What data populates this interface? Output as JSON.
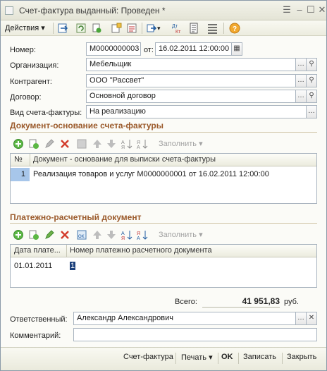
{
  "window": {
    "title": "Счет-фактура выданный: Проведен *"
  },
  "toolbar": {
    "actions_label": "Действия"
  },
  "form": {
    "number_label": "Номер:",
    "number_value": "M0000000003",
    "date_label": "от:",
    "date_value": "16.02.2011 12:00:00",
    "org_label": "Организация:",
    "org_value": "Мебельщик",
    "counterparty_label": "Контрагент:",
    "counterparty_value": "ООО \"Рассвет\"",
    "contract_label": "Договор:",
    "contract_value": "Основной договор",
    "kind_label": "Вид счета-фактуры:",
    "kind_value": "На реализацию"
  },
  "basis": {
    "title": "Документ-основание счета-фактуры",
    "fill_label": "Заполнить",
    "columns": [
      "№",
      "Документ - основание для выписки счета-фактуры"
    ],
    "rows": [
      {
        "n": "1",
        "doc": "Реализация товаров и услуг M0000000001 от 16.02.2011 12:00:00"
      }
    ]
  },
  "payment": {
    "title": "Платежно-расчетный документ",
    "fill_label": "Заполнить",
    "columns": [
      "Дата плате...",
      "Номер платежно расчетного документа"
    ],
    "rows": [
      {
        "date": "01.01.2011",
        "number": "1"
      }
    ]
  },
  "totals": {
    "label": "Всего:",
    "value": "41 951,83",
    "currency": "руб."
  },
  "responsible": {
    "label": "Ответственный:",
    "value": "Александр Александрович"
  },
  "comment": {
    "label": "Комментарий:",
    "value": ""
  },
  "footer": {
    "invoice": "Счет-фактура",
    "print": "Печать",
    "ok": "OK",
    "save": "Записать",
    "close": "Закрыть"
  }
}
